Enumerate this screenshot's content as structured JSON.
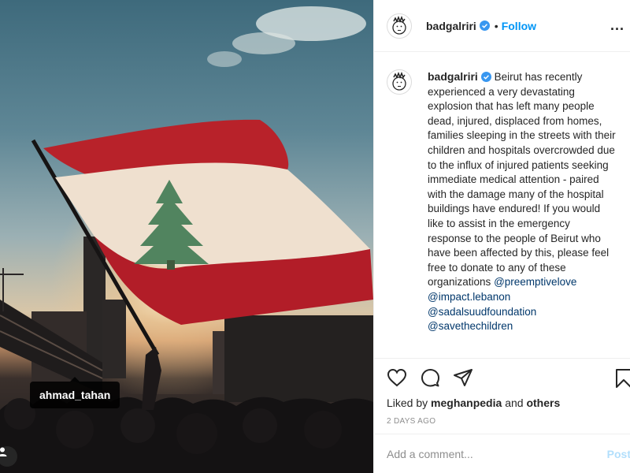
{
  "post": {
    "image_alt": "",
    "tagged_user": "ahmad_tahan"
  },
  "header": {
    "username": "badgalriri",
    "separator": "•",
    "follow_label": "Follow",
    "more_label": "..."
  },
  "caption": {
    "username": "badgalriri",
    "text": "Beirut has recently experienced a very devastating explosion that has left many people dead, injured, displaced from homes, families sleeping in the streets with their children and hospitals overcrowded due to the influx of injured patients seeking immediate medical attention - paired with the damage many of the hospital buildings have endured! If you would like to assist in the emergency response to the people of Beirut who have been affected by this, please feel free to donate to any of these organizations",
    "mentions": [
      "@preemptivelove",
      "@impact.lebanon",
      "@sadalsuudfoundation",
      "@savethechildren"
    ]
  },
  "actions": {
    "liked_by_prefix": "Liked by",
    "liked_by_user": "meghanpedia",
    "and_label": "and",
    "others_label": "others",
    "timestamp": "2 DAYS AGO"
  },
  "comment": {
    "placeholder": "Add a comment...",
    "post_label": "Post"
  },
  "colors": {
    "accent": "#0095f6",
    "verified": "#3897f0",
    "mention": "#00376b",
    "muted": "#8e8e8e"
  }
}
